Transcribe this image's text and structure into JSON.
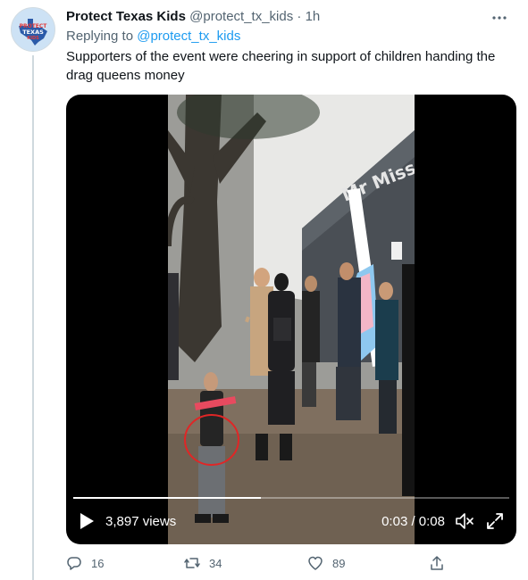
{
  "tweet": {
    "display_name": "Protect Texas Kids",
    "handle": "@protect_tx_kids",
    "separator": "·",
    "time": "1h",
    "replying_prefix": "Replying to",
    "replying_to": "@protect_tx_kids",
    "text": "Supporters of the event were cheering in support of children handing the drag queens money",
    "avatar_text": "PROTECT TEXAS KIDS"
  },
  "video": {
    "views": "3,897 views",
    "time": "0:03 / 0:08",
    "progress": 0.43,
    "storefront_sign": "Mr Miss"
  },
  "actions": {
    "replies": "16",
    "retweets": "34",
    "likes": "89"
  },
  "colors": {
    "accent": "#1d9bf0",
    "muted": "#536471",
    "thread_line": "#cfd9de"
  }
}
